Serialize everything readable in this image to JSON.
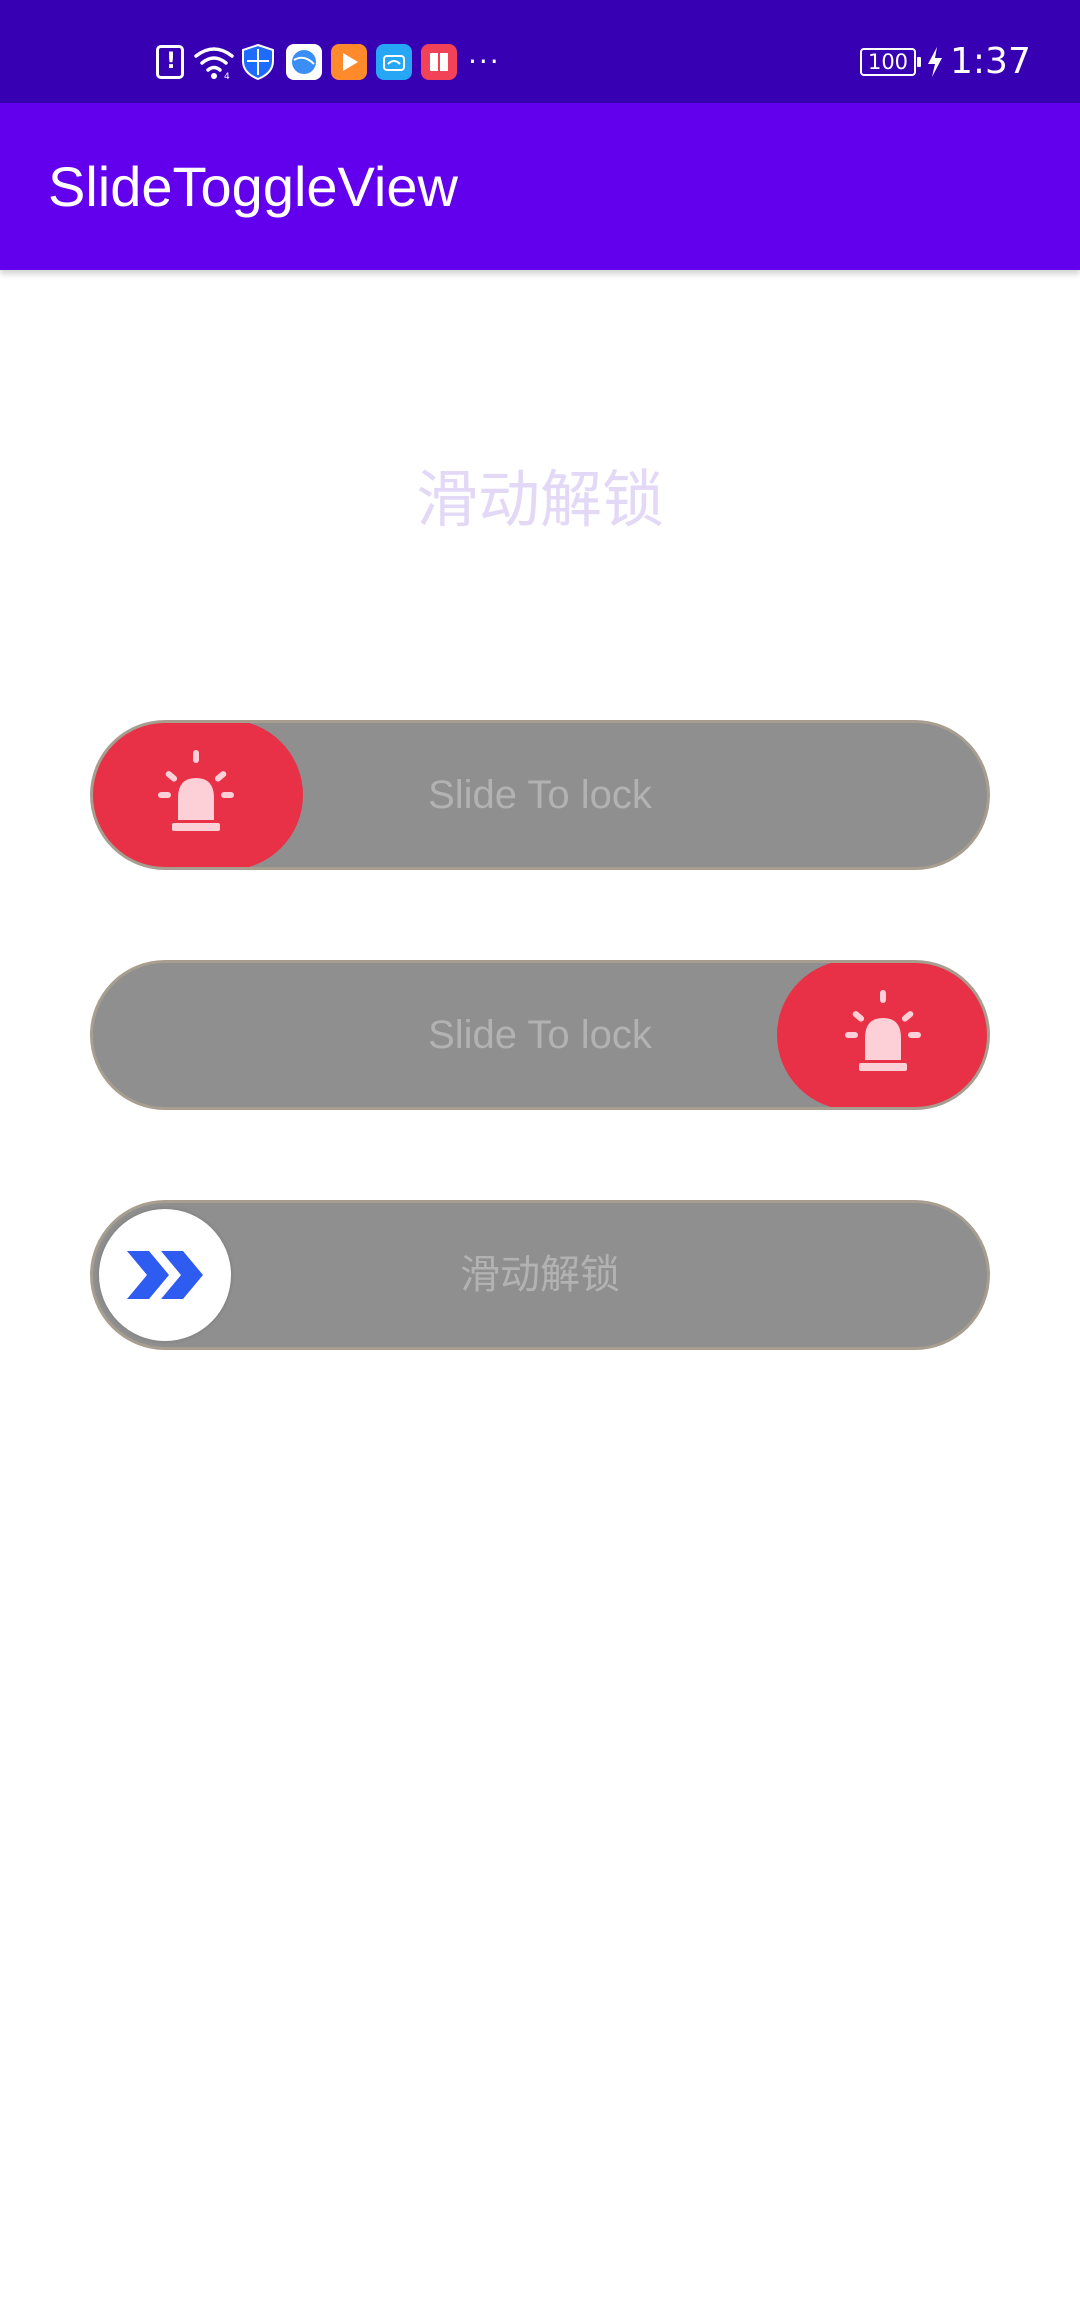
{
  "status_bar": {
    "battery": "100",
    "time": "1:37",
    "overflow": "···",
    "icons": [
      "notification-alert-icon",
      "wifi-icon",
      "shield-icon",
      "browser-app-icon",
      "video-app-icon",
      "cloud-app-icon",
      "book-app-icon",
      "charging-bolt-icon"
    ]
  },
  "app_bar": {
    "title": "SlideToggleView"
  },
  "main": {
    "hint": "滑动解锁",
    "toggles": [
      {
        "label": "Slide To lock",
        "thumb_icon": "siren-icon",
        "thumb_position": "start",
        "thumb_color": "#e83146"
      },
      {
        "label": "Slide To lock",
        "thumb_icon": "siren-icon",
        "thumb_position": "end",
        "thumb_color": "#e83146"
      },
      {
        "label": "滑动解锁",
        "thumb_icon": "double-chevron-right-icon",
        "thumb_position": "start",
        "thumb_color": "#ffffff"
      }
    ]
  },
  "colors": {
    "status_bar": "#3700b3",
    "app_bar": "#6200ee",
    "track": "#8f8f8f",
    "accent_red": "#e83146",
    "chevron_blue": "#2f5cf0"
  }
}
